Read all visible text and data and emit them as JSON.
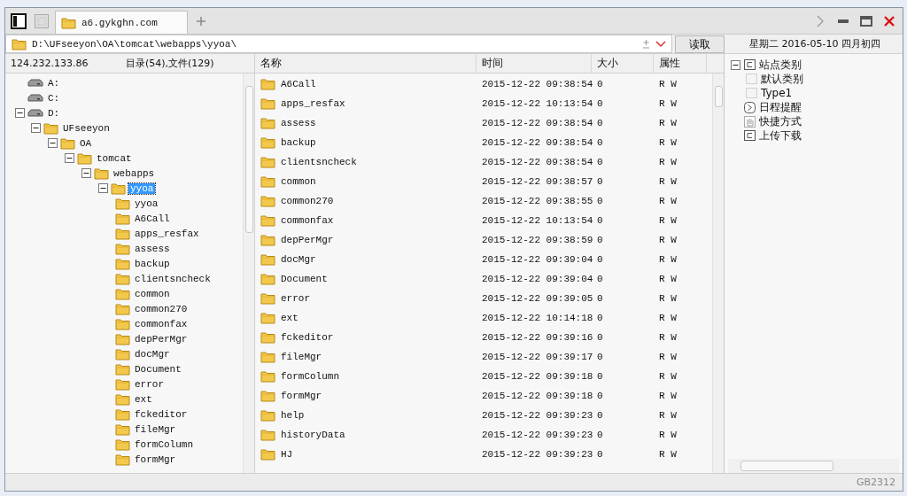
{
  "tabs": [
    {
      "label": "a6.gykghn.com",
      "selected": true
    }
  ],
  "path_bar": {
    "path": "D:\\UFseeyon\\OA\\tomcat\\webapps\\yyoa\\",
    "read_button": "读取"
  },
  "date_header": "星期二 2016-05-10 四月初四",
  "tree_header": {
    "host": "124.232.133.86",
    "counts": "目录(54),文件(129)"
  },
  "tree": [
    {
      "label": "A:",
      "kind": "drive",
      "selected": false
    },
    {
      "label": "C:",
      "kind": "drive",
      "selected": false
    },
    {
      "label": "D:",
      "kind": "drive",
      "selected": false,
      "expanded": true,
      "children": [
        {
          "label": "UFseeyon",
          "kind": "folder",
          "selected": false,
          "expanded": true,
          "children": [
            {
              "label": "OA",
              "kind": "folder",
              "selected": false,
              "expanded": true,
              "children": [
                {
                  "label": "tomcat",
                  "kind": "folder",
                  "selected": false,
                  "expanded": true,
                  "children": [
                    {
                      "label": "webapps",
                      "kind": "folder",
                      "selected": false,
                      "expanded": true,
                      "children": [
                        {
                          "label": "yyoa",
                          "kind": "folder",
                          "selected": true,
                          "expanded": true,
                          "children": [
                            {
                              "label": "yyoa",
                              "kind": "folder",
                              "selected": false
                            },
                            {
                              "label": "A6Call",
                              "kind": "folder",
                              "selected": false
                            },
                            {
                              "label": "apps_resfax",
                              "kind": "folder",
                              "selected": false
                            },
                            {
                              "label": "assess",
                              "kind": "folder",
                              "selected": false
                            },
                            {
                              "label": "backup",
                              "kind": "folder",
                              "selected": false
                            },
                            {
                              "label": "clientsncheck",
                              "kind": "folder",
                              "selected": false
                            },
                            {
                              "label": "common",
                              "kind": "folder",
                              "selected": false
                            },
                            {
                              "label": "common270",
                              "kind": "folder",
                              "selected": false
                            },
                            {
                              "label": "commonfax",
                              "kind": "folder",
                              "selected": false
                            },
                            {
                              "label": "depPerMgr",
                              "kind": "folder",
                              "selected": false
                            },
                            {
                              "label": "docMgr",
                              "kind": "folder",
                              "selected": false
                            },
                            {
                              "label": "Document",
                              "kind": "folder",
                              "selected": false
                            },
                            {
                              "label": "error",
                              "kind": "folder",
                              "selected": false
                            },
                            {
                              "label": "ext",
                              "kind": "folder",
                              "selected": false
                            },
                            {
                              "label": "fckeditor",
                              "kind": "folder",
                              "selected": false
                            },
                            {
                              "label": "fileMgr",
                              "kind": "folder",
                              "selected": false
                            },
                            {
                              "label": "formColumn",
                              "kind": "folder",
                              "selected": false
                            },
                            {
                              "label": "formMgr",
                              "kind": "folder",
                              "selected": false
                            }
                          ]
                        }
                      ]
                    }
                  ]
                }
              ]
            }
          ]
        }
      ]
    }
  ],
  "columns": [
    "名称",
    "时间",
    "大小",
    "属性"
  ],
  "rows": [
    {
      "name": "A6Call",
      "time": "2015-12-22 09:38:54",
      "size": "0",
      "attr": "R W"
    },
    {
      "name": "apps_resfax",
      "time": "2015-12-22 10:13:54",
      "size": "0",
      "attr": "R W"
    },
    {
      "name": "assess",
      "time": "2015-12-22 09:38:54",
      "size": "0",
      "attr": "R W"
    },
    {
      "name": "backup",
      "time": "2015-12-22 09:38:54",
      "size": "0",
      "attr": "R W"
    },
    {
      "name": "clientsncheck",
      "time": "2015-12-22 09:38:54",
      "size": "0",
      "attr": "R W"
    },
    {
      "name": "common",
      "time": "2015-12-22 09:38:57",
      "size": "0",
      "attr": "R W"
    },
    {
      "name": "common270",
      "time": "2015-12-22 09:38:55",
      "size": "0",
      "attr": "R W"
    },
    {
      "name": "commonfax",
      "time": "2015-12-22 10:13:54",
      "size": "0",
      "attr": "R W"
    },
    {
      "name": "depPerMgr",
      "time": "2015-12-22 09:38:59",
      "size": "0",
      "attr": "R W"
    },
    {
      "name": "docMgr",
      "time": "2015-12-22 09:39:04",
      "size": "0",
      "attr": "R W"
    },
    {
      "name": "Document",
      "time": "2015-12-22 09:39:04",
      "size": "0",
      "attr": "R W"
    },
    {
      "name": "error",
      "time": "2015-12-22 09:39:05",
      "size": "0",
      "attr": "R W"
    },
    {
      "name": "ext",
      "time": "2015-12-22 10:14:18",
      "size": "0",
      "attr": "R W"
    },
    {
      "name": "fckeditor",
      "time": "2015-12-22 09:39:16",
      "size": "0",
      "attr": "R W"
    },
    {
      "name": "fileMgr",
      "time": "2015-12-22 09:39:17",
      "size": "0",
      "attr": "R W"
    },
    {
      "name": "formColumn",
      "time": "2015-12-22 09:39:18",
      "size": "0",
      "attr": "R W"
    },
    {
      "name": "formMgr",
      "time": "2015-12-22 09:39:18",
      "size": "0",
      "attr": "R W"
    },
    {
      "name": "help",
      "time": "2015-12-22 09:39:23",
      "size": "0",
      "attr": "R W"
    },
    {
      "name": "historyData",
      "time": "2015-12-22 09:39:23",
      "size": "0",
      "attr": "R W"
    },
    {
      "name": "HJ",
      "time": "2015-12-22 09:39:23",
      "size": "0",
      "attr": "R W"
    }
  ],
  "side_tree": [
    {
      "label": "站点类别",
      "kind": "category",
      "expanded": true,
      "children": [
        {
          "label": "默认类别",
          "kind": "item"
        },
        {
          "label": "Type1",
          "kind": "item"
        }
      ]
    },
    {
      "label": "日程提醒",
      "kind": "schedule"
    },
    {
      "label": "快捷方式",
      "kind": "shortcut"
    },
    {
      "label": "上传下载",
      "kind": "transfer"
    }
  ],
  "status_bar": {
    "encoding": "GB2312"
  }
}
